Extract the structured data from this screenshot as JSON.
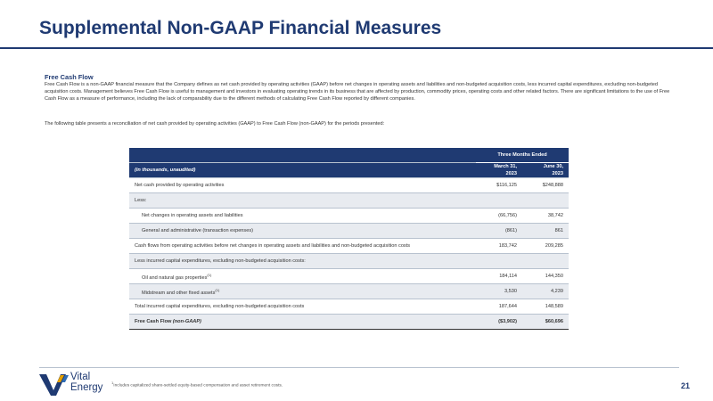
{
  "header": {
    "title": "Supplemental Non-GAAP Financial Measures"
  },
  "section": {
    "heading": "Free Cash Flow",
    "paragraph": "Free Cash Flow is a non-GAAP financial measure that the Company defines as net cash provided by operating activities (GAAP) before net changes in operating assets and liabilities and non-budgeted acquisition costs, less incurred capital expenditures, excluding non-budgeted acquisition costs. Management believes Free Cash Flow is useful to management and investors in evaluating operating trends in its business that are affected by production, commodity prices, operating costs and other related factors. There are significant limitations to the use of Free Cash Flow as a measure of performance, including the lack of comparability due to the different methods of calculating Free Cash Flow reported by different companies.",
    "intro": "The following table presents a reconciliation of net cash provided by operating activities (GAAP) to Free Cash Flow (non-GAAP) for the periods presented:"
  },
  "table": {
    "period_header": "Three Months Ended",
    "units_label": "(in thousands, unaudited)",
    "col1_line1": "March 31,",
    "col1_line2": "2023",
    "col2_line1": "June 30,",
    "col2_line2": "2023",
    "rows": [
      {
        "label": "Net cash provided by operating activities",
        "c1": "$116,125",
        "c2": "$248,888"
      },
      {
        "label": "Less:",
        "c1": "",
        "c2": ""
      },
      {
        "label": "Net changes in operating assets and liabilities",
        "c1": "(66,756)",
        "c2": "38,742"
      },
      {
        "label": "General and administrative (transaction expenses)",
        "c1": "(861)",
        "c2": "861"
      },
      {
        "label": "Cash flows from operating activities before net changes in operating assets and liabilities and non-budgeted acquisition costs",
        "c1": "183,742",
        "c2": "209,285"
      },
      {
        "label": "Less incurred capital expenditures, excluding non-budgeted acquisition costs:",
        "c1": "",
        "c2": ""
      },
      {
        "label": "Oil and natural gas properties",
        "sup": "(1)",
        "c1": "184,114",
        "c2": "144,350"
      },
      {
        "label": "Midstream and other fixed assets",
        "sup": "(1)",
        "c1": "3,530",
        "c2": "4,239"
      },
      {
        "label": "Total incurred capital expenditures, excluding non-budgeted acquisition costs",
        "c1": "187,644",
        "c2": "148,589"
      }
    ],
    "total": {
      "label_main": "Free Cash Flow ",
      "label_emph": "(non-GAAP)",
      "c1": "($3,902)",
      "c2": "$60,696"
    }
  },
  "footer": {
    "footnote_mark": "1",
    "footnote_text": "Includes capitalized share-settled equity-based compensation and asset retirement costs.",
    "logo_line1": "Vital",
    "logo_line2": "Energy",
    "page_number": "21"
  },
  "colors": {
    "brand_navy": "#1f3a72",
    "brand_blue": "#2f6db5",
    "brand_gold": "#e5a100",
    "row_shade": "#e8ebf0"
  }
}
